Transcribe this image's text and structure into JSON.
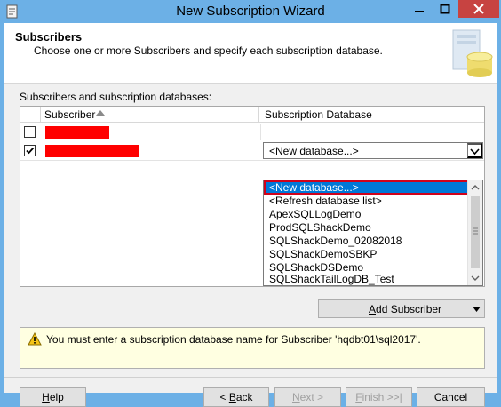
{
  "window": {
    "title": "New Subscription Wizard"
  },
  "header": {
    "title": "Subscribers",
    "subtitle": "Choose one or more Subscribers and specify each subscription database."
  },
  "list": {
    "caption": "Subscribers and subscription databases:",
    "columns": {
      "subscriber": "Subscriber",
      "database": "Subscription Database"
    },
    "rows": [
      {
        "checked": false,
        "subscriber_redacted": true
      },
      {
        "checked": true,
        "subscriber_redacted": true,
        "database_value": "<New database...>"
      }
    ]
  },
  "dropdown": {
    "options": [
      "<New database...>",
      "<Refresh database list>",
      "ApexSQLLogDemo",
      "ProdSQLShackDemo",
      "SQLShackDemo_02082018",
      "SQLShackDemoSBKP",
      "SQLShackDSDemo",
      "SQLShackTailLogDB_Test"
    ],
    "selected_index": 0
  },
  "add_subscriber": {
    "label_pre": "",
    "label_accel": "A",
    "label_post": "dd Subscriber"
  },
  "message": {
    "text": "You must enter a subscription database name for Subscriber 'hqdbt01\\sql2017'."
  },
  "buttons": {
    "help": {
      "accel": "H",
      "rest": "elp"
    },
    "back": {
      "pre": "< ",
      "accel": "B",
      "rest": "ack"
    },
    "next": {
      "accel": "N",
      "rest": "ext >"
    },
    "finish": {
      "accel": "F",
      "rest": "inish >>|"
    },
    "cancel": "Cancel"
  },
  "colors": {
    "titlebar": "#6cb0e6",
    "close": "#c74341",
    "selection": "#0078d7",
    "highlight_outline": "#d0021b",
    "redaction": "#ff0000",
    "message_bg": "#ffffe1"
  }
}
